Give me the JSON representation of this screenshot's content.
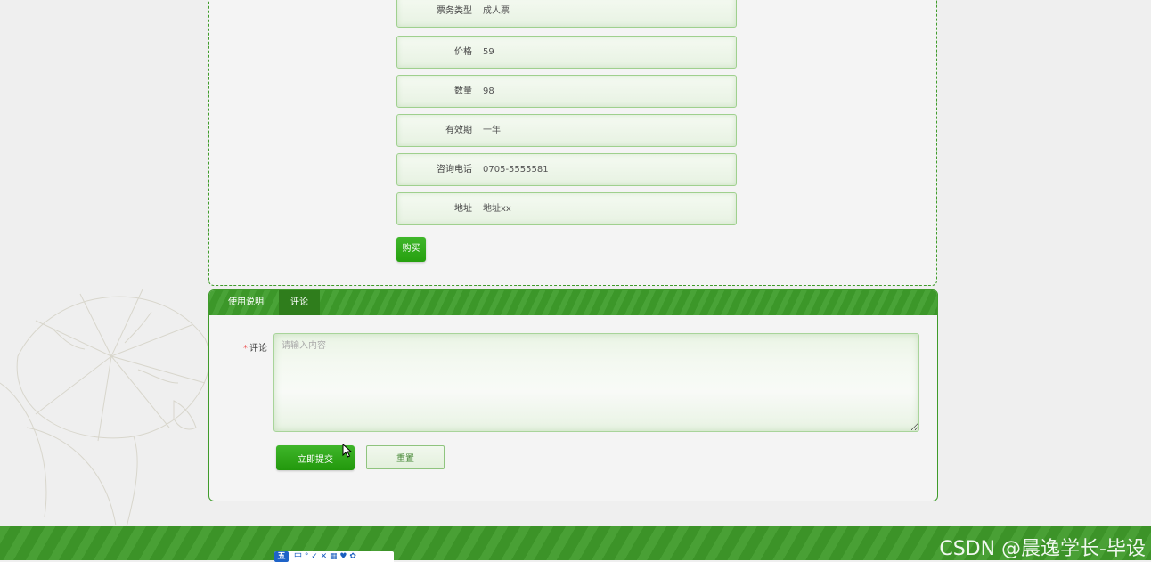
{
  "detail": {
    "fields": [
      {
        "label": "票务类型",
        "value": "成人票"
      },
      {
        "label": "价格",
        "value": "59"
      },
      {
        "label": "数量",
        "value": "98"
      },
      {
        "label": "有效期",
        "value": "一年"
      },
      {
        "label": "咨询电话",
        "value": "0705-5555581"
      },
      {
        "label": "地址",
        "value": "地址xx"
      }
    ],
    "buy_label": "购买"
  },
  "tabs": [
    {
      "label": "使用说明",
      "active": false
    },
    {
      "label": "评论",
      "active": true
    }
  ],
  "comment_form": {
    "required_mark": "*",
    "label": "评论",
    "placeholder": "请输入内容",
    "value": "",
    "submit_label": "立即提交",
    "reset_label": "重置"
  },
  "footer": {
    "ime_logo": "五",
    "ime_toolbar": "中 ° ✓ ✕ ▦ ♥ ✿",
    "watermark": "CSDN @晨逸学长-毕设"
  },
  "colors": {
    "primary_green": "#3f9b2a",
    "button_green": "#26a00f",
    "page_bg": "#efefef"
  }
}
